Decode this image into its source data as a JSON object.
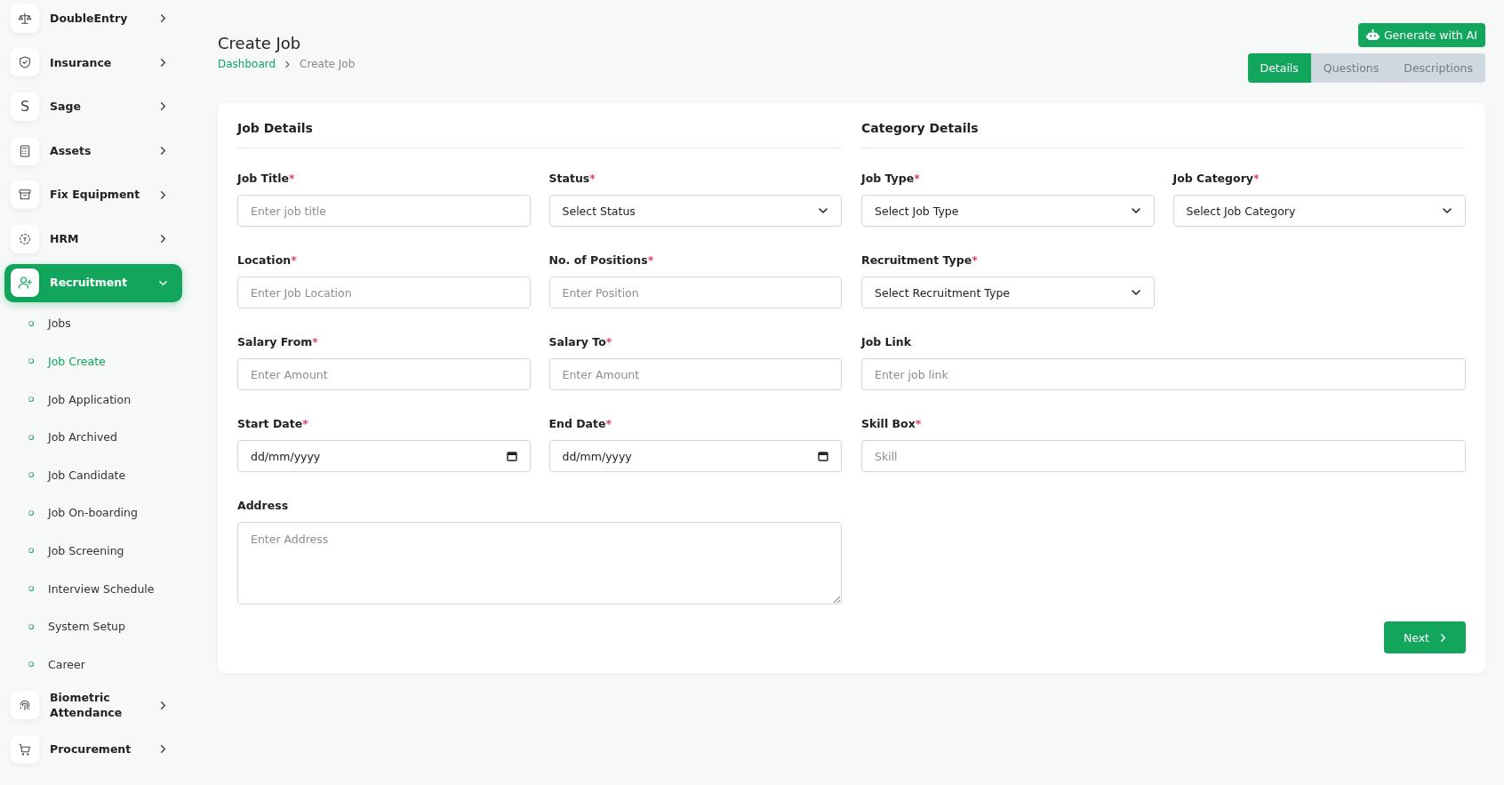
{
  "sidebar": {
    "items": [
      {
        "label": "DoubleEntry",
        "expanded": false,
        "selected": false
      },
      {
        "label": "Insurance",
        "expanded": false,
        "selected": false
      },
      {
        "label": "Sage",
        "icon_text": "S",
        "expanded": false,
        "selected": false
      },
      {
        "label": "Assets",
        "expanded": false,
        "selected": false
      },
      {
        "label": "Fix Equipment",
        "expanded": false,
        "selected": false
      },
      {
        "label": "HRM",
        "expanded": false,
        "selected": false
      },
      {
        "label": "Recruitment",
        "expanded": true,
        "selected": true,
        "children": [
          {
            "label": "Jobs",
            "selected": false
          },
          {
            "label": "Job Create",
            "selected": true
          },
          {
            "label": "Job Application",
            "selected": false
          },
          {
            "label": "Job Archived",
            "selected": false
          },
          {
            "label": "Job Candidate",
            "selected": false
          },
          {
            "label": "Job On-boarding",
            "selected": false
          },
          {
            "label": "Job Screening",
            "selected": false
          },
          {
            "label": "Interview Schedule",
            "selected": false
          },
          {
            "label": "System Setup",
            "selected": false
          },
          {
            "label": "Career",
            "selected": false
          }
        ]
      },
      {
        "label": "Biometric Attendance",
        "expanded": false,
        "selected": false
      },
      {
        "label": "Procurement",
        "expanded": false,
        "selected": false
      }
    ]
  },
  "header": {
    "title": "Create Job",
    "breadcrumb": [
      {
        "label": "Dashboard",
        "link": true
      },
      {
        "label": "Create Job",
        "link": false
      }
    ],
    "generate_button": "Generate with AI",
    "tabs": [
      {
        "label": "Details",
        "selected": true
      },
      {
        "label": "Questions",
        "selected": false
      },
      {
        "label": "Descriptions",
        "selected": false
      }
    ]
  },
  "sections": [
    {
      "title": "Job Details",
      "fields": [
        {
          "label": "Job Title",
          "required_mark": "*",
          "kind": "text",
          "placeholder": "Enter job title"
        },
        {
          "label": "Status",
          "required_mark": "*",
          "kind": "select",
          "value": "Select Status"
        },
        {
          "label": "Location",
          "required_mark": "*",
          "kind": "text",
          "placeholder": "Enter Job Location"
        },
        {
          "label": "No. of Positions",
          "required_mark": "*",
          "kind": "text",
          "placeholder": "Enter Position"
        },
        {
          "label": "Salary From",
          "required_mark": "*",
          "kind": "text",
          "placeholder": "Enter Amount"
        },
        {
          "label": "Salary To",
          "required_mark": "*",
          "kind": "text",
          "placeholder": "Enter Amount"
        },
        {
          "label": "Start Date",
          "required_mark": "*",
          "kind": "date",
          "value": "dd/mm/yyyy"
        },
        {
          "label": "End Date",
          "required_mark": "*",
          "kind": "date",
          "value": "dd/mm/yyyy"
        },
        {
          "label": "Address",
          "kind": "textarea",
          "wide": true,
          "placeholder": "Enter Address"
        }
      ]
    },
    {
      "title": "Category Details",
      "fields": [
        {
          "label": "Job Type",
          "required_mark": "*",
          "kind": "select",
          "value": "Select Job Type"
        },
        {
          "label": "Job Category",
          "required_mark": "*",
          "kind": "select",
          "value": "Select Job Category"
        },
        {
          "label": "Recruitment Type",
          "required_mark": "*",
          "kind": "select",
          "value": "Select Recruitment Type"
        },
        {
          "kind": "empty"
        },
        {
          "label": "Job Link",
          "kind": "text",
          "wide": true,
          "placeholder": "Enter job link"
        },
        {
          "label": "Skill Box",
          "required_mark": "*",
          "kind": "text",
          "wide": true,
          "placeholder": "Skill"
        }
      ]
    }
  ],
  "next_button": "Next"
}
